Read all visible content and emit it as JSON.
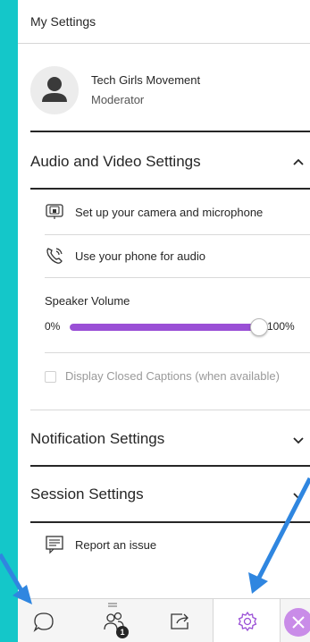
{
  "header": {
    "title": "My Settings"
  },
  "profile": {
    "name": "Tech Girls Movement",
    "role": "Moderator"
  },
  "audio_video": {
    "title": "Audio and Video Settings",
    "expanded": true,
    "camera_label": "Set up your camera and microphone",
    "phone_label": "Use your phone for audio",
    "speaker_volume": {
      "label": "Speaker Volume",
      "min_label": "0%",
      "max_label": "100%",
      "value_fraction": 1.0
    },
    "captions_label": "Display Closed Captions (when available)"
  },
  "notification_settings": {
    "title": "Notification Settings"
  },
  "session_settings": {
    "title": "Session Settings"
  },
  "report_issue": {
    "label": "Report an issue"
  },
  "footer": {
    "tabs": [
      {
        "id": "chat",
        "icon": "chat-icon"
      },
      {
        "id": "attendees",
        "icon": "attendees-icon",
        "badge": "1"
      },
      {
        "id": "share",
        "icon": "share-content-icon"
      },
      {
        "id": "settings",
        "icon": "gear-icon",
        "active": true
      },
      {
        "id": "close",
        "icon": "close-icon"
      }
    ]
  },
  "colors": {
    "background": "#14c7c9",
    "accent": "#9a4fd6",
    "arrow": "#2f86e0",
    "close_button": "#c98ce8"
  }
}
